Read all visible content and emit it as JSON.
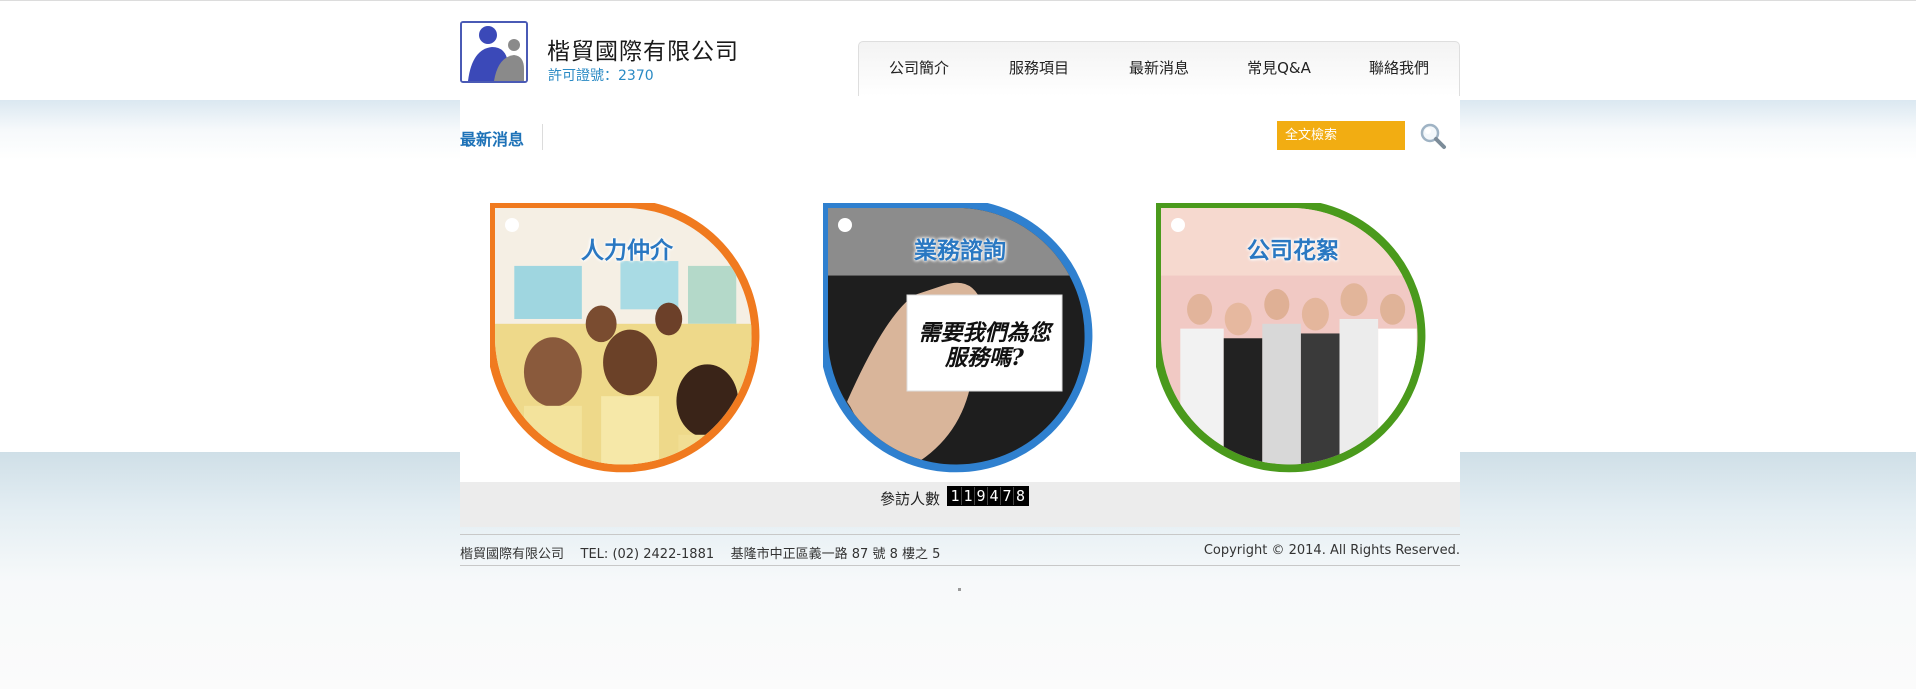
{
  "header": {
    "company_name": "楷貿國際有限公司",
    "license": "許可證號：2370"
  },
  "nav": {
    "items": [
      {
        "label": "公司簡介"
      },
      {
        "label": "服務項目"
      },
      {
        "label": "最新消息"
      },
      {
        "label": "常見Q&A"
      },
      {
        "label": "聯絡我們"
      }
    ]
  },
  "subheader": {
    "section_title": "最新消息",
    "search_placeholder": "全文檢索"
  },
  "tiles": [
    {
      "title": "人力仲介",
      "color": "#f07a1f",
      "icon": "workers-photo"
    },
    {
      "title": "業務諮詢",
      "color": "#2f80cf",
      "icon": "business-card-photo",
      "card_line1": "需要我們為您",
      "card_line2": "服務嗎?"
    },
    {
      "title": "公司花絮",
      "color": "#4a9a1c",
      "icon": "team-photo"
    }
  ],
  "counter": {
    "label": "參訪人數",
    "digits": [
      "1",
      "1",
      "9",
      "4",
      "7",
      "8"
    ]
  },
  "footer": {
    "info": "楷貿國際有限公司    TEL: (02) 2422-1881    基隆市中正區義一路 87 號 8 樓之 5",
    "copyright": "Copyright © 2014. All Rights Reserved."
  },
  "colors": {
    "accent_blue": "#1f73b8",
    "search_orange": "#f2ad12",
    "orange": "#f07a1f",
    "blue": "#2f80cf",
    "green": "#4a9a1c"
  }
}
